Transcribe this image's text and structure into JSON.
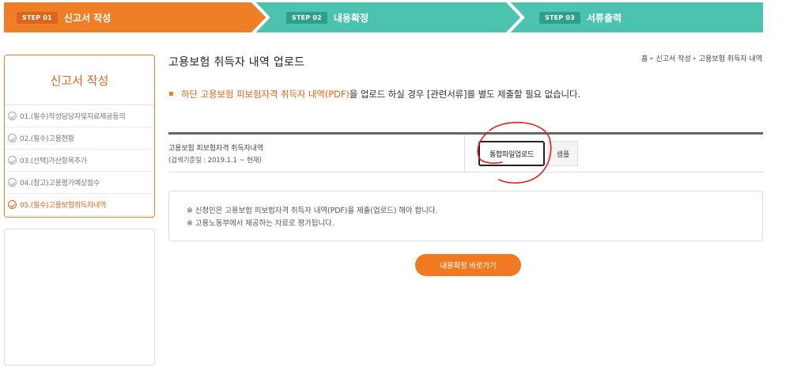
{
  "steps": [
    {
      "badge": "STEP 01",
      "label": "신고서 작성",
      "color": "#f07e26"
    },
    {
      "badge": "STEP 02",
      "label": "내용확정",
      "color": "#4cc3ae"
    },
    {
      "badge": "STEP 03",
      "label": "서류출력",
      "color": "#4cc3ae"
    }
  ],
  "sidebar": {
    "title": "신고서 작성",
    "items": [
      {
        "label": "01.(필수)작성담당자및자료제공동의"
      },
      {
        "label": "02.(필수)고용현황"
      },
      {
        "label": "03.(선택)가산항목추가"
      },
      {
        "label": "04.(참고)고용평가예상점수"
      },
      {
        "label": "05.(필수)고용보험취득자내역"
      }
    ]
  },
  "page": {
    "title": "고용보험 취득자 내역 업로드",
    "breadcrumb": [
      "홈",
      "신고서 작성",
      "고용보험 취득자 내역"
    ],
    "notice_highlight": "하단 고용보험 피보험자격 취득자 내역(PDF)",
    "notice_rest": "을 업로드 하실 경우 [관련서류]를 별도 제출할 필요 없습니다."
  },
  "upload": {
    "row_label": "고용보험 피보험자격 취득자내역",
    "row_sublabel": "(검색기준일 : 2019.1.1 ~ 현재)",
    "upload_button": "통합파일업로드",
    "sample_button": "샘플"
  },
  "info": {
    "line1": "※ 신청인은 고용보험 피보험자격 취득자 내역(PDF)을 제출(업로드) 해야 합니다.",
    "line2": "※ 고용노동부에서 제공하는 자료로 평가됩니다."
  },
  "actions": {
    "goto_button": "내용확정 바로가기"
  },
  "colors": {
    "accent": "#f07e26",
    "step_inactive": "#4cc3ae",
    "annotation": "#e02020"
  }
}
